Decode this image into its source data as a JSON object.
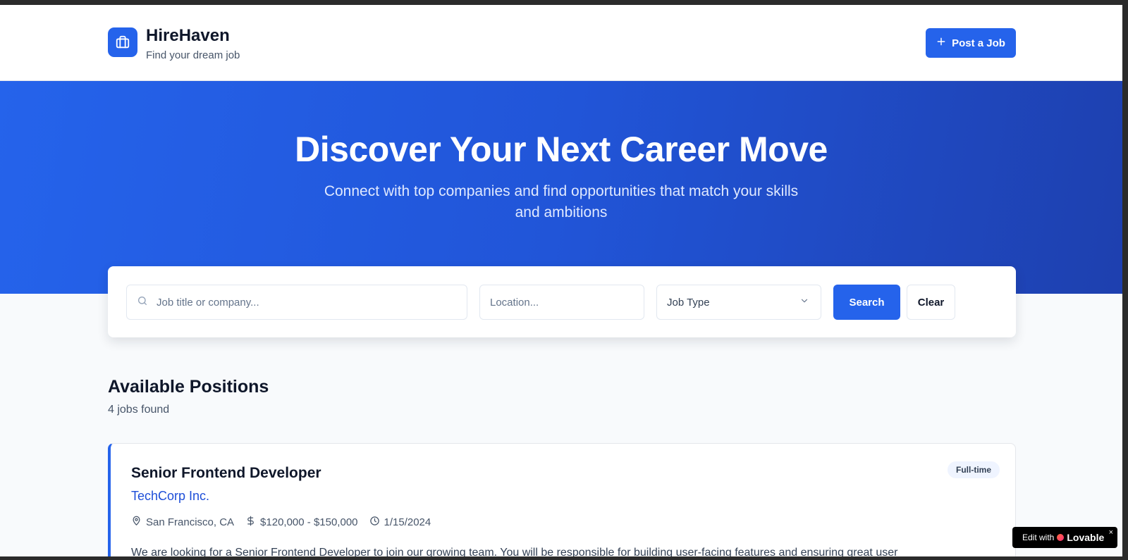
{
  "header": {
    "brand_name": "HireHaven",
    "brand_tagline": "Find your dream job",
    "post_job_label": "Post a Job",
    "logo_icon": "briefcase-icon"
  },
  "hero": {
    "title": "Discover Your Next Career Move",
    "subtitle": "Connect with top companies and find opportunities that match your skills and ambitions"
  },
  "search": {
    "keyword_placeholder": "Job title or company...",
    "location_placeholder": "Location...",
    "job_type_value": "Job Type",
    "search_label": "Search",
    "clear_label": "Clear"
  },
  "listing": {
    "title": "Available Positions",
    "count_text": "4 jobs found",
    "jobs": [
      {
        "title": "Senior Frontend Developer",
        "company": "TechCorp Inc.",
        "location": "San Francisco, CA",
        "salary": "$120,000 - $150,000",
        "date": "1/15/2024",
        "type": "Full-time",
        "description": "We are looking for a Senior Frontend Developer to join our growing team. You will be responsible for building user-facing features and ensuring great user"
      }
    ]
  },
  "lovable_badge": {
    "prefix": "Edit with",
    "brand": "Lovable",
    "close": "×"
  },
  "colors": {
    "primary": "#2563eb",
    "hero_end": "#1e40af",
    "company_link": "#1d4ed8",
    "page_bg": "#f8fafc"
  }
}
